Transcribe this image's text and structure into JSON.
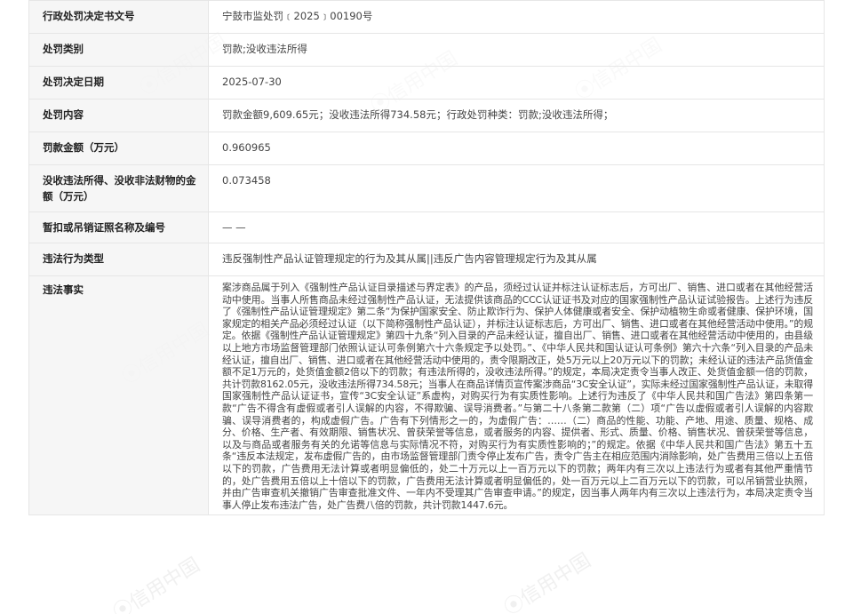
{
  "rows": [
    {
      "label": "行政处罚决定书文号",
      "value": "宁鼓市监处罚﹝2025﹞00190号"
    },
    {
      "label": "处罚类别",
      "value": "罚款;没收违法所得"
    },
    {
      "label": "处罚决定日期",
      "value": "2025-07-30"
    },
    {
      "label": "处罚内容",
      "value": "罚款金额9,609.65元；没收违法所得734.58元；行政处罚种类：罚款;没收违法所得；"
    },
    {
      "label": "罚款金额（万元）",
      "value": "0.960965"
    },
    {
      "label": "没收违法所得、没收非法财物的金额（万元）",
      "value": "0.073458"
    },
    {
      "label": "暂扣或吊销证照名称及编号",
      "value": "— —"
    },
    {
      "label": "违法行为类型",
      "value": "违反强制性产品认证管理规定的行为及其从属||违反广告内容管理规定行为及其从属"
    },
    {
      "label": "违法事实",
      "value": "案涉商品属于列入《强制性产品认证目录描述与界定表》的产品，须经过认证并标注认证标志后，方可出厂、销售、进口或者在其他经营活动中使用。当事人所售商品未经过强制性产品认证，无法提供该商品的CCC认证证书及对应的国家强制性产品认证试验报告。上述行为违反了《强制性产品认证管理规定》第二条“为保护国家安全、防止欺诈行为、保护人体健康或者安全、保护动植物生命或者健康、保护环境，国家规定的相关产品必须经过认证（以下简称强制性产品认证），并标注认证标志后，方可出厂、销售、进口或者在其他经营活动中使用。”的规定。依据《强制性产品认证管理规定》第四十九条“列入目录的产品未经认证，擅自出厂、销售、进口或者在其他经营活动中使用的，由县级以上地方市场监督管理部门依照认证认可条例第六十六条规定予以处罚。”、《中华人民共和国认证认可条例》第六十六条“列入目录的产品未经认证，擅自出厂、销售、进口或者在其他经营活动中使用的，责令限期改正，处5万元以上20万元以下的罚款；未经认证的违法产品货值金额不足1万元的，处货值金额2倍以下的罚款；有违法所得的，没收违法所得。”的规定，本局决定责令当事人改正、处货值金额一倍的罚款，共计罚款8162.05元，没收违法所得734.58元；当事人在商品详情页宣传案涉商品“3C安全认证”，实际未经过国家强制性产品认证，未取得国家强制性产品认证证书，宣传“3C安全认证”系虚构，对购买行为有实质性影响。上述行为违反了《中华人民共和国广告法》第四条第一款“广告不得含有虚假或者引人误解的内容，不得欺骗、误导消费者。”与第二十八条第二款第（二）项“广告以虚假或者引人误解的内容欺骗、误导消费者的，构成虚假广告。广告有下列情形之一的，为虚假广告：……（二）商品的性能、功能、产地、用途、质量、规格、成分、价格、生产者、有效期限、销售状况、曾获荣誉等信息，或者服务的内容、提供者、形式、质量、价格、销售状况、曾获荣誉等信息，以及与商品或者服务有关的允诺等信息与实际情况不符，对购买行为有实质性影响的；”的规定。依据《中华人民共和国广告法》第五十五条“违反本法规定，发布虚假广告的，由市场监督管理部门责令停止发布广告，责令广告主在相应范围内消除影响，处广告费用三倍以上五倍以下的罚款，广告费用无法计算或者明显偏低的，处二十万元以上一百万元以下的罚款；两年内有三次以上违法行为或者有其他严重情节的，处广告费用五倍以上十倍以下的罚款，广告费用无法计算或者明显偏低的，处一百万元以上二百万元以下的罚款，可以吊销营业执照，并由广告审查机关撤销广告审查批准文件、一年内不受理其广告审查申请。”的规定，因当事人两年内有三次以上违法行为，本局决定责令当事人停止发布违法广告，处广告费八倍的罚款，共计罚款1447.6元。"
    }
  ],
  "watermark": {
    "text": "信用中国",
    "icon": "credit-china-logo-icon"
  }
}
